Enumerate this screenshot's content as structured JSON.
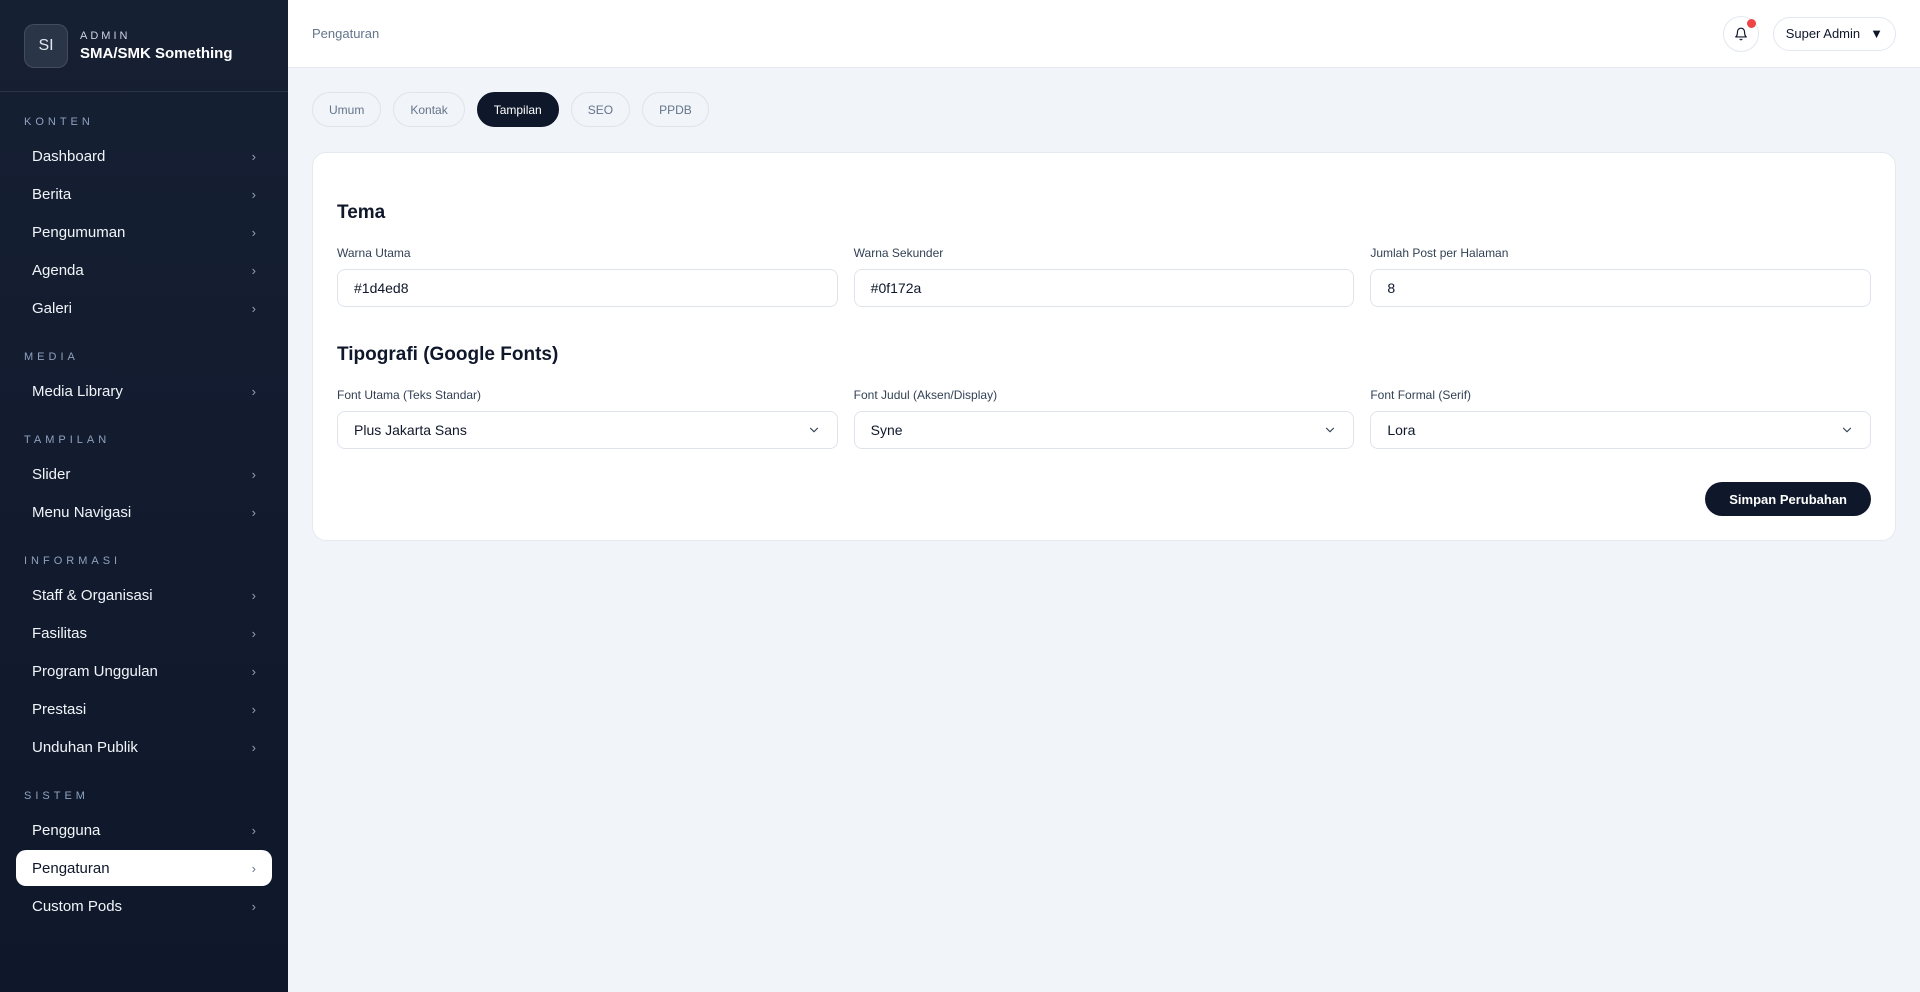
{
  "brand": {
    "initials": "SI",
    "kicker": "ADMIN",
    "name": "SMA/SMK Something"
  },
  "sidebar": {
    "sections": [
      {
        "label": "KONTEN",
        "items": [
          "Dashboard",
          "Berita",
          "Pengumuman",
          "Agenda",
          "Galeri"
        ]
      },
      {
        "label": "MEDIA",
        "items": [
          "Media Library"
        ]
      },
      {
        "label": "TAMPILAN",
        "items": [
          "Slider",
          "Menu Navigasi"
        ]
      },
      {
        "label": "INFORMASI",
        "items": [
          "Staff & Organisasi",
          "Fasilitas",
          "Program Unggulan",
          "Prestasi",
          "Unduhan Publik"
        ]
      },
      {
        "label": "SISTEM",
        "items": [
          "Pengguna",
          "Pengaturan",
          "Custom Pods"
        ]
      }
    ],
    "active_item": "Pengaturan",
    "chevron": "›"
  },
  "topbar": {
    "breadcrumb": "Pengaturan",
    "bell_icon": "bell-icon",
    "has_notification": true,
    "user_label": "Super Admin",
    "user_caret": "▼"
  },
  "tabs": {
    "items": [
      "Umum",
      "Kontak",
      "Tampilan",
      "SEO",
      "PPDB"
    ],
    "active": "Tampilan"
  },
  "theme": {
    "title": "Tema",
    "primary_color": {
      "label": "Warna Utama",
      "value": "#1d4ed8"
    },
    "secondary_color": {
      "label": "Warna Sekunder",
      "value": "#0f172a"
    },
    "posts_per_page": {
      "label": "Jumlah Post per Halaman",
      "value": "8"
    }
  },
  "typography": {
    "title": "Tipografi (Google Fonts)",
    "main_font": {
      "label": "Font Utama (Teks Standar)",
      "value": "Plus Jakarta Sans"
    },
    "heading_font": {
      "label": "Font Judul (Aksen/Display)",
      "value": "Syne"
    },
    "formal_font": {
      "label": "Font Formal (Serif)",
      "value": "Lora"
    }
  },
  "actions": {
    "save_label": "Simpan Perubahan"
  },
  "colors": {
    "sidebar_bg": "#0f172a",
    "accent": "#0f172a",
    "notification": "#ef4444",
    "page_bg": "#f1f4f8"
  }
}
